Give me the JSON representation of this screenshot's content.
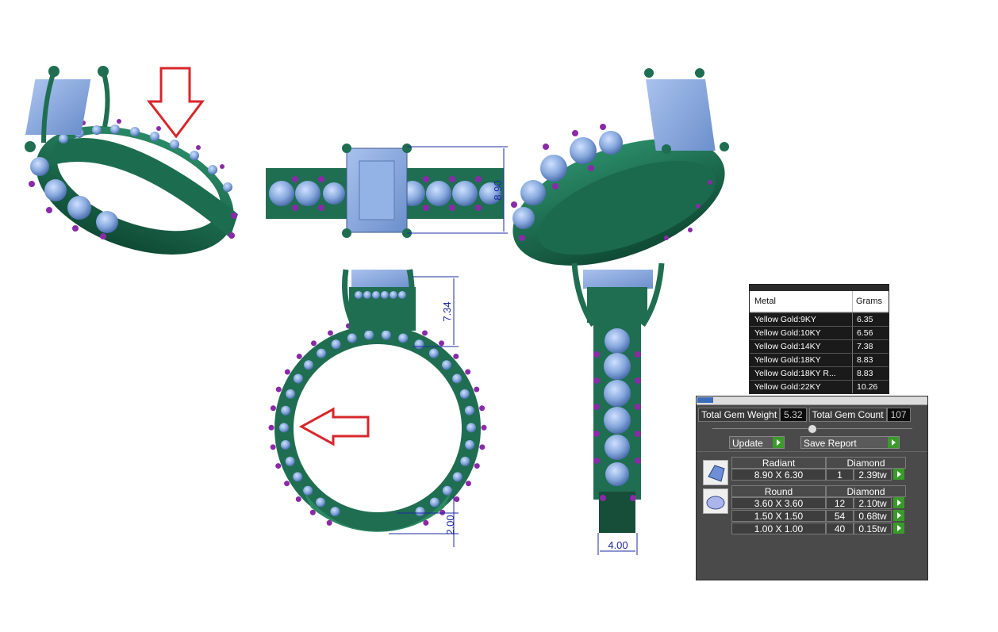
{
  "colors": {
    "metal": "#1f6e52",
    "gem": "#86a8dc",
    "prong": "#8a2aa8",
    "dimension": "#1e2aa0",
    "annotation": "#d8262a"
  },
  "dimensions": {
    "height_top": "8.90",
    "height_front": "7.34",
    "band_bottom": "2.00",
    "band_width": "4.00"
  },
  "metal_table": {
    "headers": [
      "Metal",
      "Grams"
    ],
    "rows": [
      {
        "metal": "Yellow Gold:9KY",
        "grams": "6.35"
      },
      {
        "metal": "Yellow Gold:10KY",
        "grams": "6.56"
      },
      {
        "metal": "Yellow Gold:14KY",
        "grams": "7.38"
      },
      {
        "metal": "Yellow Gold:18KY",
        "grams": "8.83"
      },
      {
        "metal": "Yellow Gold:18KY R...",
        "grams": "8.83"
      },
      {
        "metal": "Yellow Gold:22KY",
        "grams": "10.26"
      }
    ]
  },
  "gem_panel": {
    "total_weight_label": "Total Gem Weight",
    "total_weight": "5.32",
    "total_count_label": "Total Gem Count",
    "total_count": "107",
    "update_label": "Update",
    "save_label": "Save Report",
    "groups": [
      {
        "shape": "Radiant",
        "material": "Diamond",
        "rows": [
          {
            "size": "8.90 X 6.30",
            "count": "1",
            "tw": "2.39tw"
          }
        ]
      },
      {
        "shape": "Round",
        "material": "Diamond",
        "rows": [
          {
            "size": "3.60 X 3.60",
            "count": "12",
            "tw": "2.10tw"
          },
          {
            "size": "1.50 X 1.50",
            "count": "54",
            "tw": "0.68tw"
          },
          {
            "size": "1.00 X 1.00",
            "count": "40",
            "tw": "0.15tw"
          }
        ]
      }
    ]
  }
}
